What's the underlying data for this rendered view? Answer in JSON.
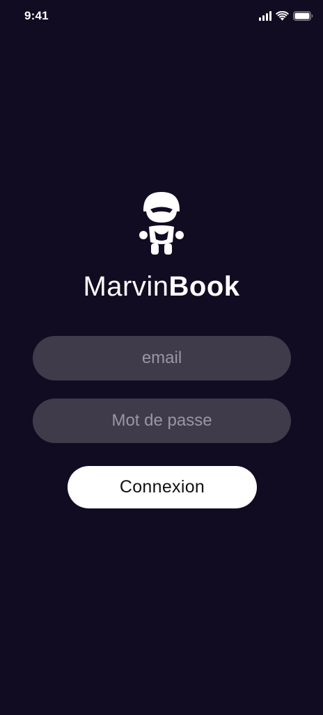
{
  "status_bar": {
    "time": "9:41",
    "icons": [
      "signal-icon",
      "wifi-icon",
      "battery-icon"
    ]
  },
  "app": {
    "logo_icon": "robot-icon",
    "brand_light": "Marvin",
    "brand_bold": "Book"
  },
  "form": {
    "email_placeholder": "email",
    "email_value": "",
    "password_placeholder": "Mot de passe",
    "password_value": "",
    "submit_label": "Connexion"
  },
  "colors": {
    "background": "#120c22",
    "field_background": "#403b4b",
    "placeholder": "#9a96a3",
    "button_background": "#ffffff",
    "button_text": "#111111"
  }
}
